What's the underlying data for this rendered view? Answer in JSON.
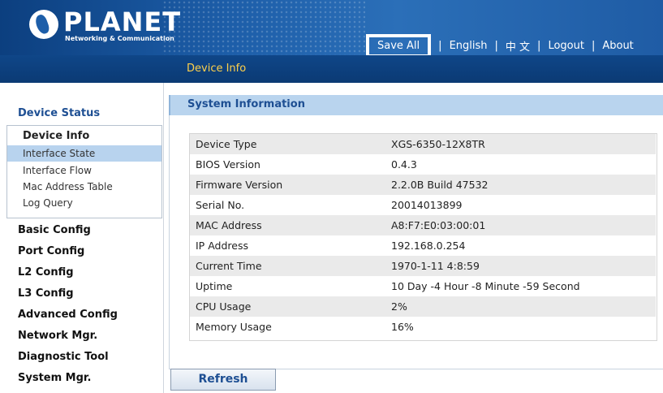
{
  "header": {
    "brand": "PLANET",
    "tagline": "Networking & Communication",
    "nav": {
      "save_all": "Save All",
      "english": "English",
      "chinese": "中 文",
      "logout": "Logout",
      "about": "About",
      "separator": "|"
    },
    "page_title": "Device Info"
  },
  "sidebar": {
    "section_title": "Device Status",
    "sub_items": [
      {
        "label": "Device Info"
      },
      {
        "label": "Interface State"
      },
      {
        "label": "Interface Flow"
      },
      {
        "label": "Mac Address Table"
      },
      {
        "label": "Log Query"
      }
    ],
    "menu": [
      {
        "label": "Basic Config"
      },
      {
        "label": "Port Config"
      },
      {
        "label": "L2 Config"
      },
      {
        "label": "L3 Config"
      },
      {
        "label": "Advanced Config"
      },
      {
        "label": "Network Mgr."
      },
      {
        "label": "Diagnostic Tool"
      },
      {
        "label": "System Mgr."
      }
    ]
  },
  "main": {
    "panel_title": "System Information",
    "rows": [
      {
        "key": "Device Type",
        "value": "XGS-6350-12X8TR"
      },
      {
        "key": "BIOS Version",
        "value": "0.4.3"
      },
      {
        "key": "Firmware Version",
        "value": "2.2.0B Build 47532"
      },
      {
        "key": "Serial No.",
        "value": "20014013899"
      },
      {
        "key": "MAC Address",
        "value": "A8:F7:E0:03:00:01"
      },
      {
        "key": "IP Address",
        "value": "192.168.0.254"
      },
      {
        "key": "Current Time",
        "value": "1970-1-11 4:8:59"
      },
      {
        "key": "Uptime",
        "value": "10 Day  -4 Hour  -8 Minute -59  Second"
      },
      {
        "key": "CPU Usage",
        "value": "2%"
      },
      {
        "key": "Memory Usage",
        "value": "16%"
      }
    ],
    "refresh_label": "Refresh"
  },
  "colors": {
    "header_blue": "#1d5ea9",
    "subbar_navy": "#0b3a74",
    "title_gold": "#ffd04a",
    "panel_header": "#b9d4ee",
    "active_item": "#b8d3ee",
    "accent_text": "#1e4f93"
  }
}
